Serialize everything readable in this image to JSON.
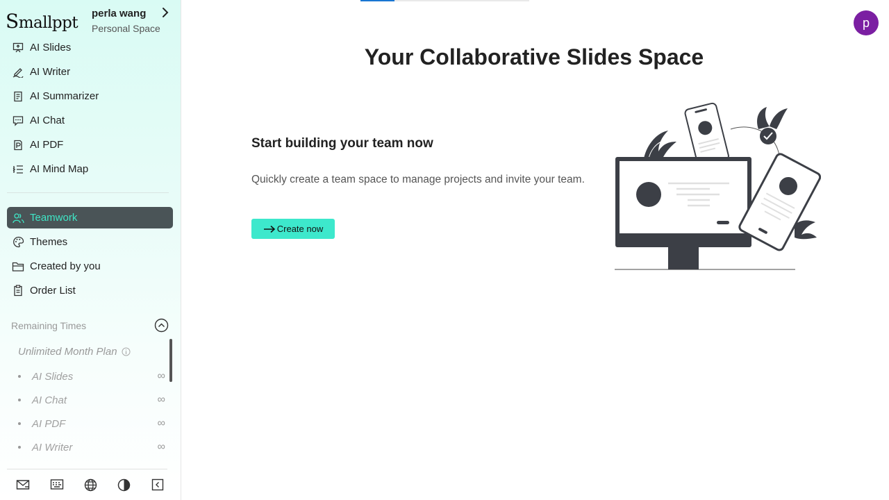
{
  "app": {
    "logo_cap": "S",
    "logo_rest": "mallppt"
  },
  "user": {
    "name": "perla wang",
    "space": "Personal Space"
  },
  "nav_tools": [
    {
      "label": "AI Slides",
      "icon": "presentation-icon"
    },
    {
      "label": "AI Writer",
      "icon": "pen-icon"
    },
    {
      "label": "AI Summarizer",
      "icon": "document-icon"
    },
    {
      "label": "AI Chat",
      "icon": "chat-icon"
    },
    {
      "label": "AI PDF",
      "icon": "pdf-icon"
    },
    {
      "label": "AI Mind Map",
      "icon": "mindmap-icon"
    }
  ],
  "nav_workspace": [
    {
      "label": "Teamwork",
      "icon": "team-icon",
      "active": true
    },
    {
      "label": "Themes",
      "icon": "palette-icon"
    },
    {
      "label": "Created by you",
      "icon": "folder-icon"
    },
    {
      "label": "Order List",
      "icon": "clipboard-icon"
    }
  ],
  "remaining": {
    "title": "Remaining Times",
    "plan": "Unlimited Month Plan",
    "items": [
      {
        "label": "AI Slides",
        "value": "∞"
      },
      {
        "label": "AI Chat",
        "value": "∞"
      },
      {
        "label": "AI PDF",
        "value": "∞"
      },
      {
        "label": "AI Writer",
        "value": "∞"
      }
    ]
  },
  "footer_icons": [
    "mail-icon",
    "keyboard-icon",
    "globe-icon",
    "contrast-icon",
    "collapse-sidebar-icon"
  ],
  "main": {
    "avatar_letter": "p",
    "headline": "Your Collaborative Slides Space",
    "subheading": "Start building your team now",
    "description": "Quickly create a team space to manage projects and invite your team.",
    "create_label": "Create now"
  },
  "colors": {
    "accent": "#3de8cc",
    "active_nav_bg": "#4a5457",
    "avatar_bg": "#7b1fa2",
    "tab_indicator": "#1976d2"
  }
}
